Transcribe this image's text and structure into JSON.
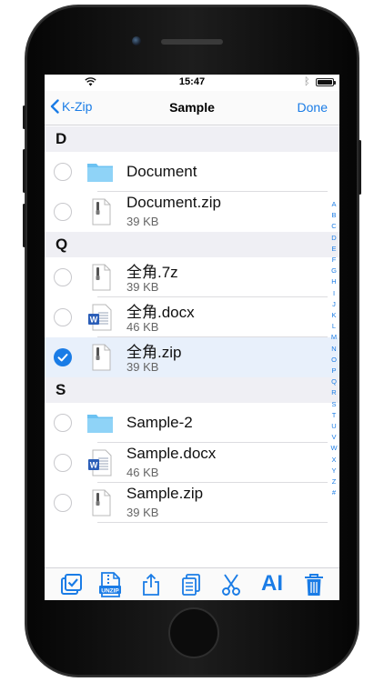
{
  "status_bar": {
    "time": "15:47"
  },
  "nav": {
    "back_label": "K-Zip",
    "title": "Sample",
    "done_label": "Done"
  },
  "sections": [
    {
      "header": "D",
      "items": [
        {
          "name": "Document",
          "type": "folder",
          "selected": false
        },
        {
          "name": "Document.zip",
          "size": "39 KB",
          "type": "zip",
          "selected": false
        }
      ]
    },
    {
      "header": "Q",
      "items": [
        {
          "name": "全角.7z",
          "size": "39 KB",
          "type": "zip",
          "selected": false
        },
        {
          "name": "全角.docx",
          "size": "46 KB",
          "type": "docx",
          "selected": false
        },
        {
          "name": "全角.zip",
          "size": "39 KB",
          "type": "zip",
          "selected": true
        }
      ]
    },
    {
      "header": "S",
      "items": [
        {
          "name": "Sample-2",
          "type": "folder",
          "selected": false
        },
        {
          "name": "Sample.docx",
          "size": "46 KB",
          "type": "docx",
          "selected": false
        },
        {
          "name": "Sample.zip",
          "size": "39 KB",
          "type": "zip",
          "selected": false
        }
      ]
    }
  ],
  "index_letters": [
    "A",
    "B",
    "C",
    "D",
    "E",
    "F",
    "G",
    "H",
    "I",
    "J",
    "K",
    "L",
    "M",
    "N",
    "O",
    "P",
    "Q",
    "R",
    "S",
    "T",
    "U",
    "V",
    "W",
    "X",
    "Y",
    "Z",
    "#"
  ],
  "toolbar": {
    "unzip_label": "UNZIP",
    "rename_label": "AI",
    "icons": [
      "select-all-icon",
      "unzip-icon",
      "share-icon",
      "copy-icon",
      "cut-icon",
      "rename-icon",
      "trash-icon"
    ]
  },
  "colors": {
    "accent": "#1a7ce6",
    "section_bg": "#efeff4",
    "selected_row": "#e8f0fb",
    "folder": "#6cc2f2"
  }
}
